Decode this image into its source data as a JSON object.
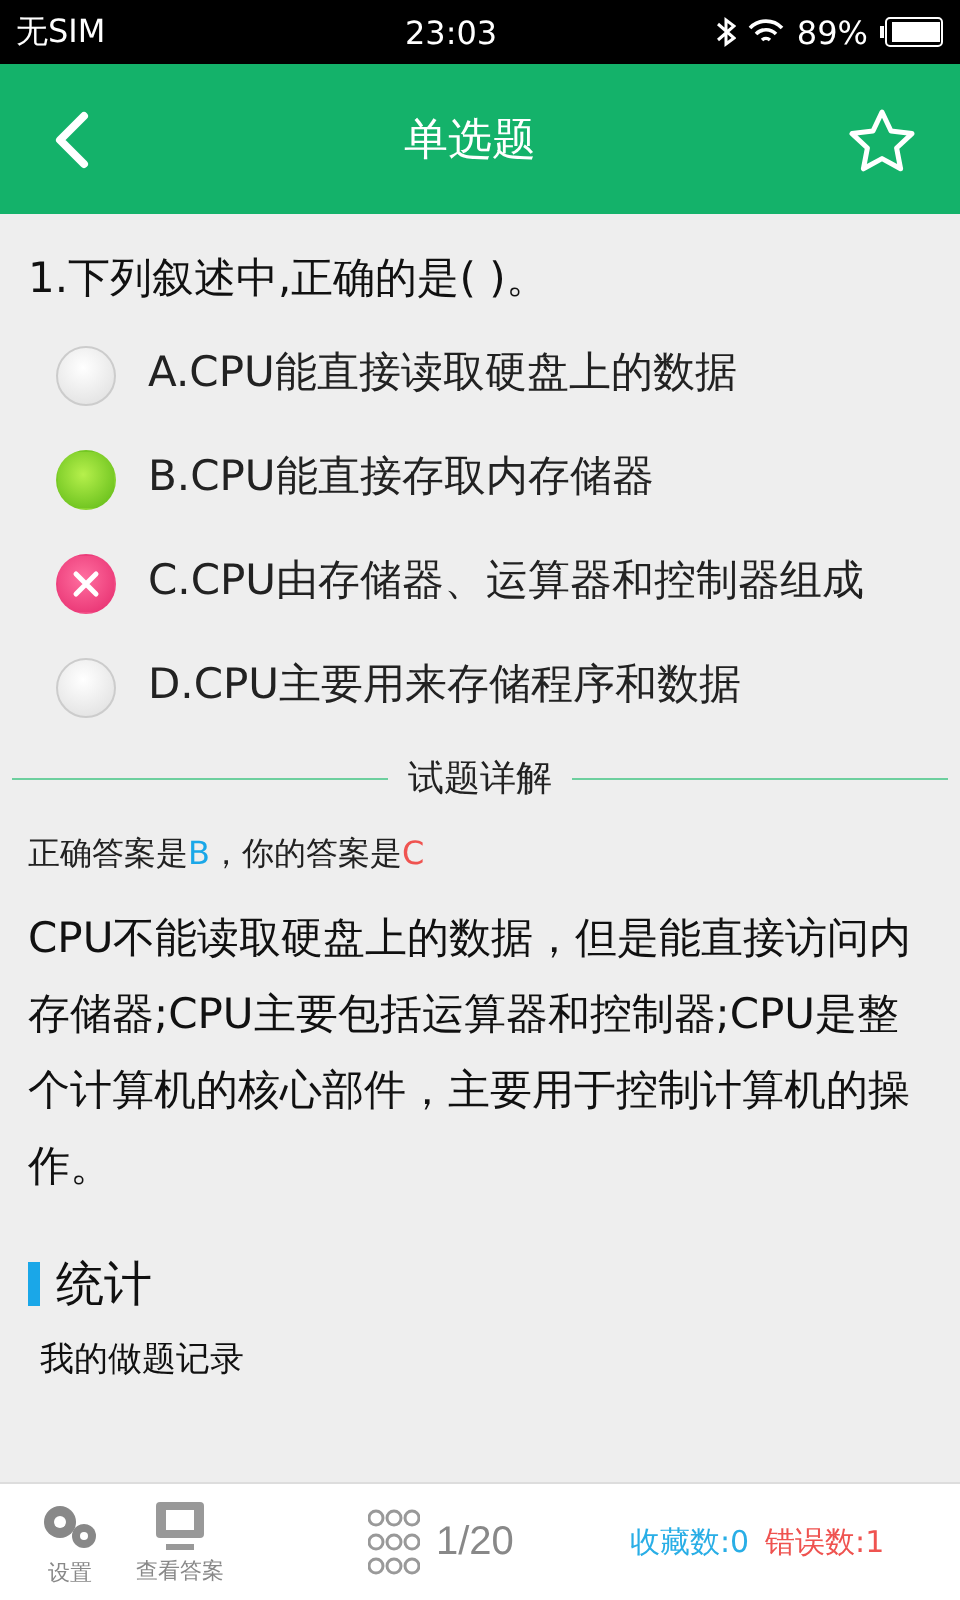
{
  "status_bar": {
    "carrier": "无SIM",
    "time": "23:03",
    "battery": "89%"
  },
  "header": {
    "title": "单选题",
    "favorited": false
  },
  "question": {
    "text": "1.下列叙述中,正确的是( )。",
    "options": [
      {
        "text": "A.CPU能直接读取硬盘上的数据",
        "selected": false,
        "correct": false
      },
      {
        "text": "B.CPU能直接存取内存储器",
        "selected": false,
        "correct": true
      },
      {
        "text": "C.CPU由存储器、运算器和控制器组成",
        "selected": true,
        "correct": false
      },
      {
        "text": "D.CPU主要用来存储程序和数据",
        "selected": false,
        "correct": false
      }
    ]
  },
  "details": {
    "heading": "试题详解",
    "correct_label": "正确答案是",
    "correct_answer": "B",
    "your_label": "，你的答案是",
    "your_answer": "C",
    "explanation": "CPU不能读取硬盘上的数据，但是能直接访问内存储器;CPU主要包括运算器和控制器;CPU是整个计算机的核心部件，主要用于控制计算机的操作。"
  },
  "stats": {
    "heading": "统计",
    "record_label": "我的做题记录"
  },
  "bottom_bar": {
    "settings": "设置",
    "view_answer": "查看答案",
    "progress": "1/20",
    "favorites": "收藏数:0",
    "errors": "错误数:1"
  }
}
